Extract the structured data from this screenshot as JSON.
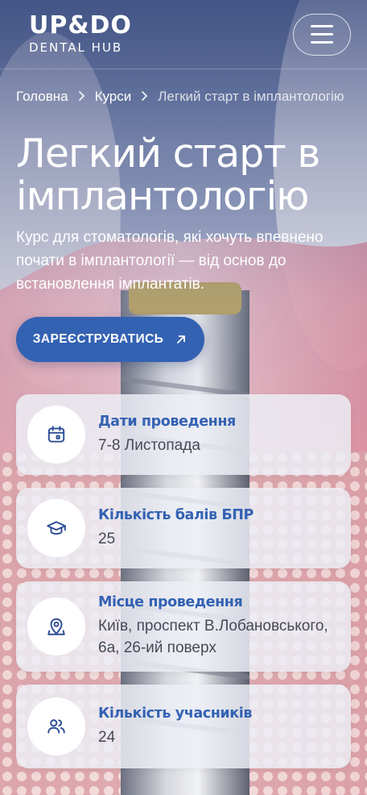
{
  "header": {
    "logo_main": "UP&DO",
    "logo_sub": "DENTAL HUB",
    "menu_icon": "hamburger-icon"
  },
  "breadcrumb": {
    "items": [
      "Головна",
      "Курси",
      "Легкий старт в імплантологію"
    ],
    "separator_icon": "chevron-right-icon"
  },
  "hero": {
    "title_line1": "Легкий старт в",
    "title_line2": "імплантологію",
    "description": "Курс для стоматологів, які хочуть впевнено почати в імплантології — від основ до встановлення імплантатів.",
    "cta_label": "ЗАРЕЄСТРУВАТИСЬ",
    "cta_icon": "arrow-up-right-icon"
  },
  "info": [
    {
      "icon": "calendar-icon",
      "label": "Дати проведення",
      "value": "7-8 Листопада"
    },
    {
      "icon": "graduation-cap-icon",
      "label": "Кількість балів БПР",
      "value": "25"
    },
    {
      "icon": "map-pin-icon",
      "label": "Місце проведення",
      "value": "Київ, проспект В.Лобановського, 6а, 26-ий поверх"
    },
    {
      "icon": "users-icon",
      "label": "Кількість учасників",
      "value": "24"
    }
  ],
  "colors": {
    "accent": "#3462b3",
    "label": "#3462b3",
    "value_text": "#444a55",
    "card_bg": "#eceef6"
  }
}
